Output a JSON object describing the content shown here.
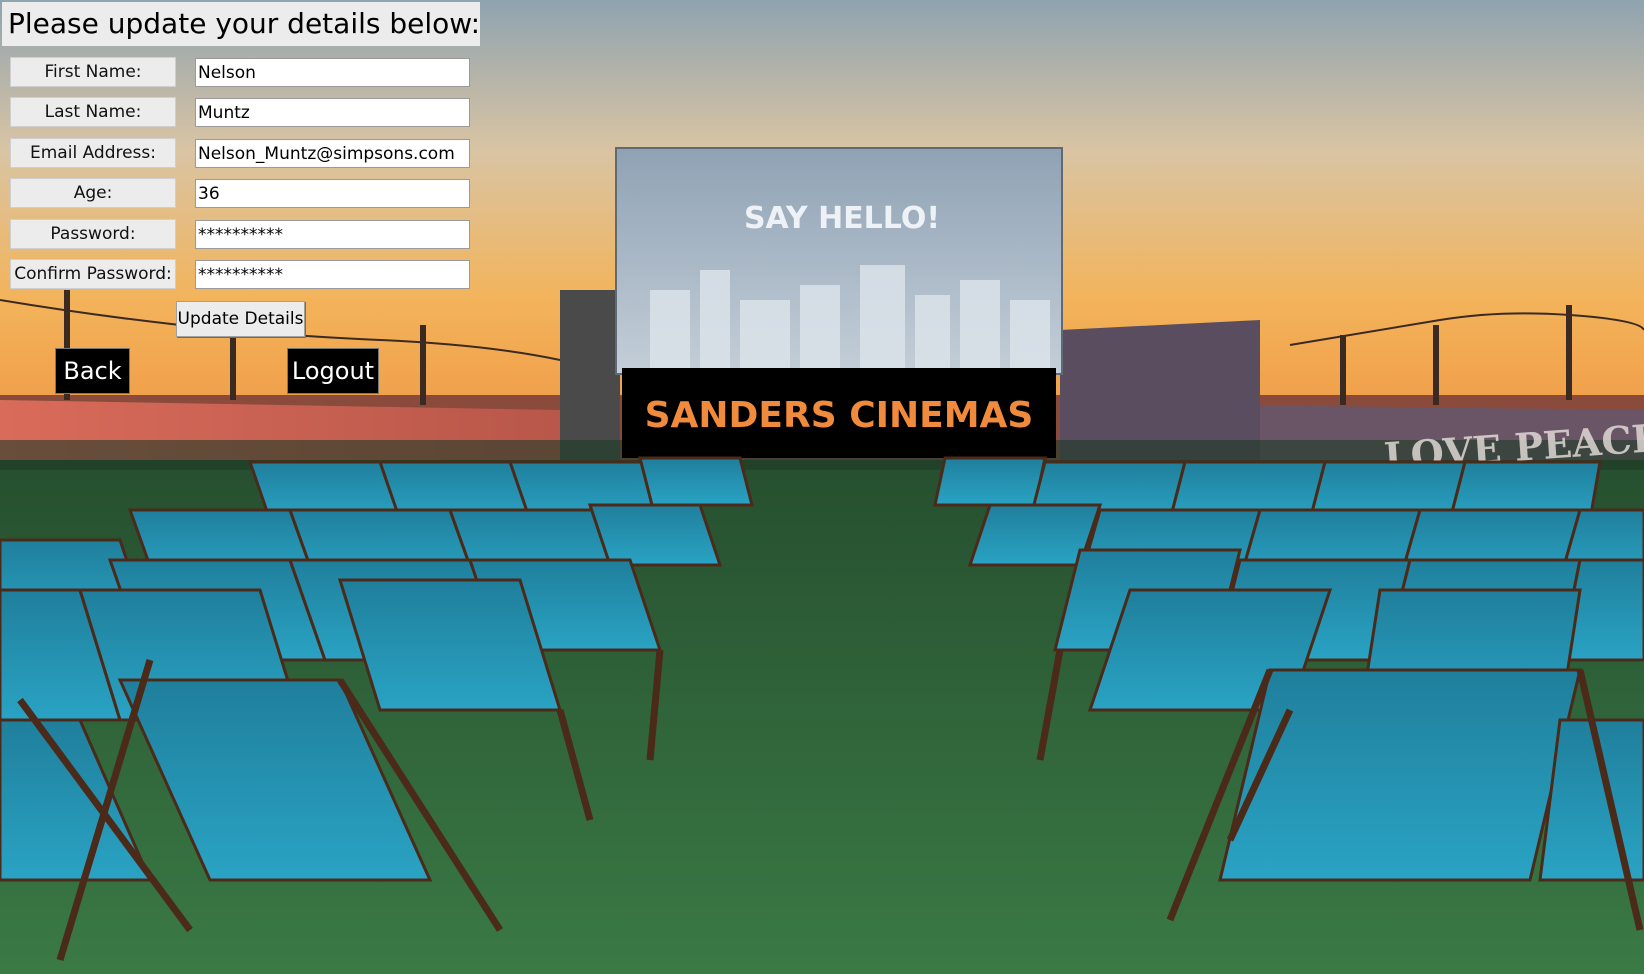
{
  "form": {
    "title": "Please update your details below:",
    "fields": [
      {
        "label": "First Name:",
        "value": "Nelson",
        "type": "text"
      },
      {
        "label": "Last Name:",
        "value": "Muntz",
        "type": "text"
      },
      {
        "label": "Email Address:",
        "value": "Nelson_Muntz@simpsons.com",
        "type": "text"
      },
      {
        "label": "Age:",
        "value": "36",
        "type": "text"
      },
      {
        "label": "Password:",
        "value": "**********",
        "type": "password"
      },
      {
        "label": "Confirm Password:",
        "value": "**********",
        "type": "password"
      }
    ],
    "update_button": "Update Details"
  },
  "nav": {
    "back_button": "Back",
    "logout_button": "Logout"
  },
  "background": {
    "brand_banner": "SANDERS CINEMAS",
    "screen_text": "SAY HELLO!",
    "wall_text": "LOVE PEACE",
    "colors": {
      "brand_orange": "#f08a3c",
      "sky_top": "#7f9aad",
      "sky_horizon": "#f4b25b",
      "chair_teal": "#1f8fae",
      "turf_green": "#2f6a3b"
    }
  }
}
